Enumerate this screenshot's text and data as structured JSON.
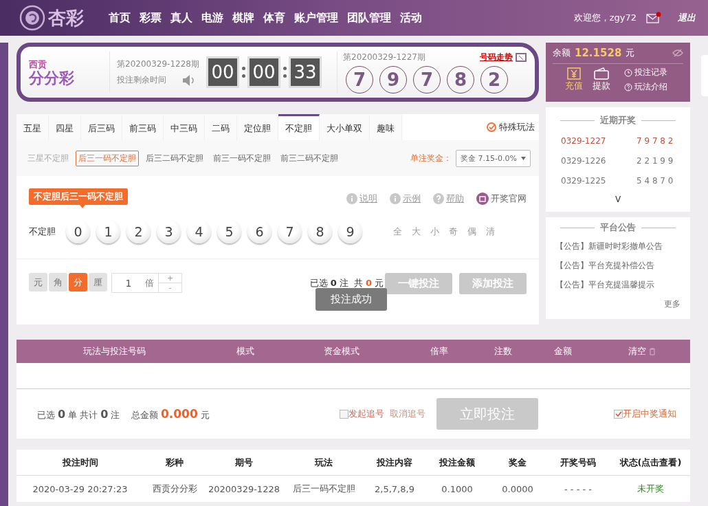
{
  "header": {
    "logo_text": "杏彩",
    "nav": [
      "首页",
      "彩票",
      "真人",
      "电游",
      "棋牌",
      "体育",
      "账户管理",
      "团队管理",
      "活动"
    ],
    "welcome": "欢迎您，zgy72",
    "mail_unread": true,
    "logout": "退出"
  },
  "lottery": {
    "region": "西贡",
    "name": "分分彩",
    "current_issue": "第20200329-1228期",
    "countdown_label": "投注剩余时间",
    "countdown": [
      "00",
      "00",
      "33"
    ],
    "last_issue": "第20200329-1227期",
    "trend_link": "号码走势",
    "results": [
      "7",
      "9",
      "7",
      "8",
      "2"
    ]
  },
  "account": {
    "balance_label": "余额",
    "balance": "12.1528",
    "unit": "元",
    "actions": [
      {
        "label": "充值",
        "kind": "deposit",
        "selected": true
      },
      {
        "label": "提款",
        "kind": "withdraw",
        "selected": false
      }
    ],
    "links": [
      {
        "label": "投注记录",
        "kind": "clock"
      },
      {
        "label": "玩法介绍",
        "kind": "help"
      }
    ]
  },
  "tabs": [
    {
      "label": "五星",
      "selected": false
    },
    {
      "label": "四星",
      "selected": false
    },
    {
      "label": "后三码",
      "selected": false
    },
    {
      "label": "前三码",
      "selected": false
    },
    {
      "label": "中三码",
      "selected": false
    },
    {
      "label": "二码",
      "selected": false
    },
    {
      "label": "定位胆",
      "selected": false
    },
    {
      "label": "不定胆",
      "selected": true
    },
    {
      "label": "大小单双",
      "selected": false
    },
    {
      "label": "趣味",
      "selected": false
    }
  ],
  "special_play": "特殊玩法",
  "subtabs": [
    {
      "label": "三星不定胆",
      "selected": false,
      "disabled": true
    },
    {
      "label": "后三一码不定胆",
      "selected": true,
      "disabled": false
    },
    {
      "label": "后三二码不定胆",
      "selected": false,
      "disabled": false
    },
    {
      "label": "前三一码不定胆",
      "selected": false,
      "disabled": false
    },
    {
      "label": "前三二码不定胆",
      "selected": false,
      "disabled": false
    }
  ],
  "prize_label": "单注奖金：",
  "prize_select": "奖金 7.15-0.0%",
  "play_badge": "不定胆后三一码不定胆",
  "help_links": [
    {
      "label": "说明",
      "kind": "info"
    },
    {
      "label": "示例",
      "kind": "info"
    },
    {
      "label": "帮助",
      "kind": "help"
    },
    {
      "label": "开奖官网",
      "kind": "official"
    }
  ],
  "row_label": "不定胆",
  "balls": [
    {
      "label": "0",
      "selected": false
    },
    {
      "label": "1",
      "selected": false
    },
    {
      "label": "2",
      "selected": false
    },
    {
      "label": "3",
      "selected": false
    },
    {
      "label": "4",
      "selected": false
    },
    {
      "label": "5",
      "selected": false
    },
    {
      "label": "6",
      "selected": false
    },
    {
      "label": "7",
      "selected": false
    },
    {
      "label": "8",
      "selected": false
    },
    {
      "label": "9",
      "selected": false
    }
  ],
  "quick_picks": [
    "全",
    "大",
    "小",
    "奇",
    "偶",
    "清"
  ],
  "units": [
    {
      "label": "元",
      "selected": false
    },
    {
      "label": "角",
      "selected": false
    },
    {
      "label": "分",
      "selected": true
    },
    {
      "label": "厘",
      "selected": false
    }
  ],
  "multiplier": {
    "value": "1",
    "unit": "倍",
    "plus": "+",
    "minus": "-"
  },
  "bet_summary": {
    "selected_prefix": "已选",
    "selected_count": "0",
    "count_unit": "注",
    "total_prefix": "共",
    "total": "0",
    "total_unit": "元"
  },
  "bet_buttons": [
    {
      "label": "一键投注",
      "disabled": true
    },
    {
      "label": "添加投注",
      "disabled": true
    }
  ],
  "toast": "投注成功",
  "recent": {
    "title": "近期开奖",
    "rows": [
      {
        "issue": "0329-1227",
        "numbers": "7 9 7 8 2",
        "latest": true
      },
      {
        "issue": "0329-1226",
        "numbers": "2 2 1 9 9",
        "latest": false
      },
      {
        "issue": "0329-1225",
        "numbers": "5 4 8 7 0",
        "latest": false
      }
    ],
    "toggle": "V"
  },
  "notices": {
    "title": "平台公告",
    "items": [
      "【公告】新疆时时彩撤单公告",
      "【公告】平台充提补偿公告",
      "【公告】平台充提温馨提示"
    ],
    "more": "更多"
  },
  "cart": {
    "columns": [
      "玩法与投注号码",
      "模式",
      "资金模式",
      "倍率",
      "注数",
      "金额",
      "清空"
    ]
  },
  "cart_summary": {
    "selected_prefix": "已选",
    "orders": "0",
    "orders_unit": "单 共计",
    "bets": "0",
    "bets_unit": "注",
    "total_label": "总金额",
    "total": "0.000",
    "total_unit": "元",
    "chase": {
      "label": "发起追号",
      "checked": false
    },
    "cancel_chase": "取消追号",
    "submit": {
      "label": "立即投注",
      "disabled": true
    },
    "notify": {
      "label": "开启中奖通知",
      "checked": true
    }
  },
  "history": {
    "columns": [
      "投注时间",
      "彩种",
      "期号",
      "玩法",
      "投注内容",
      "投注金额",
      "奖金",
      "开奖号码",
      "状态(点击查看)"
    ],
    "rows": [
      {
        "cells": [
          "2020-03-29 20:27:23",
          "西贡分分彩",
          "20200329-1228",
          "后三一码不定胆",
          "2,5,7,8,9",
          "0.1000",
          "0.0000",
          "- - - - -",
          "未开奖"
        ],
        "color": "#3a8a2a"
      }
    ]
  }
}
